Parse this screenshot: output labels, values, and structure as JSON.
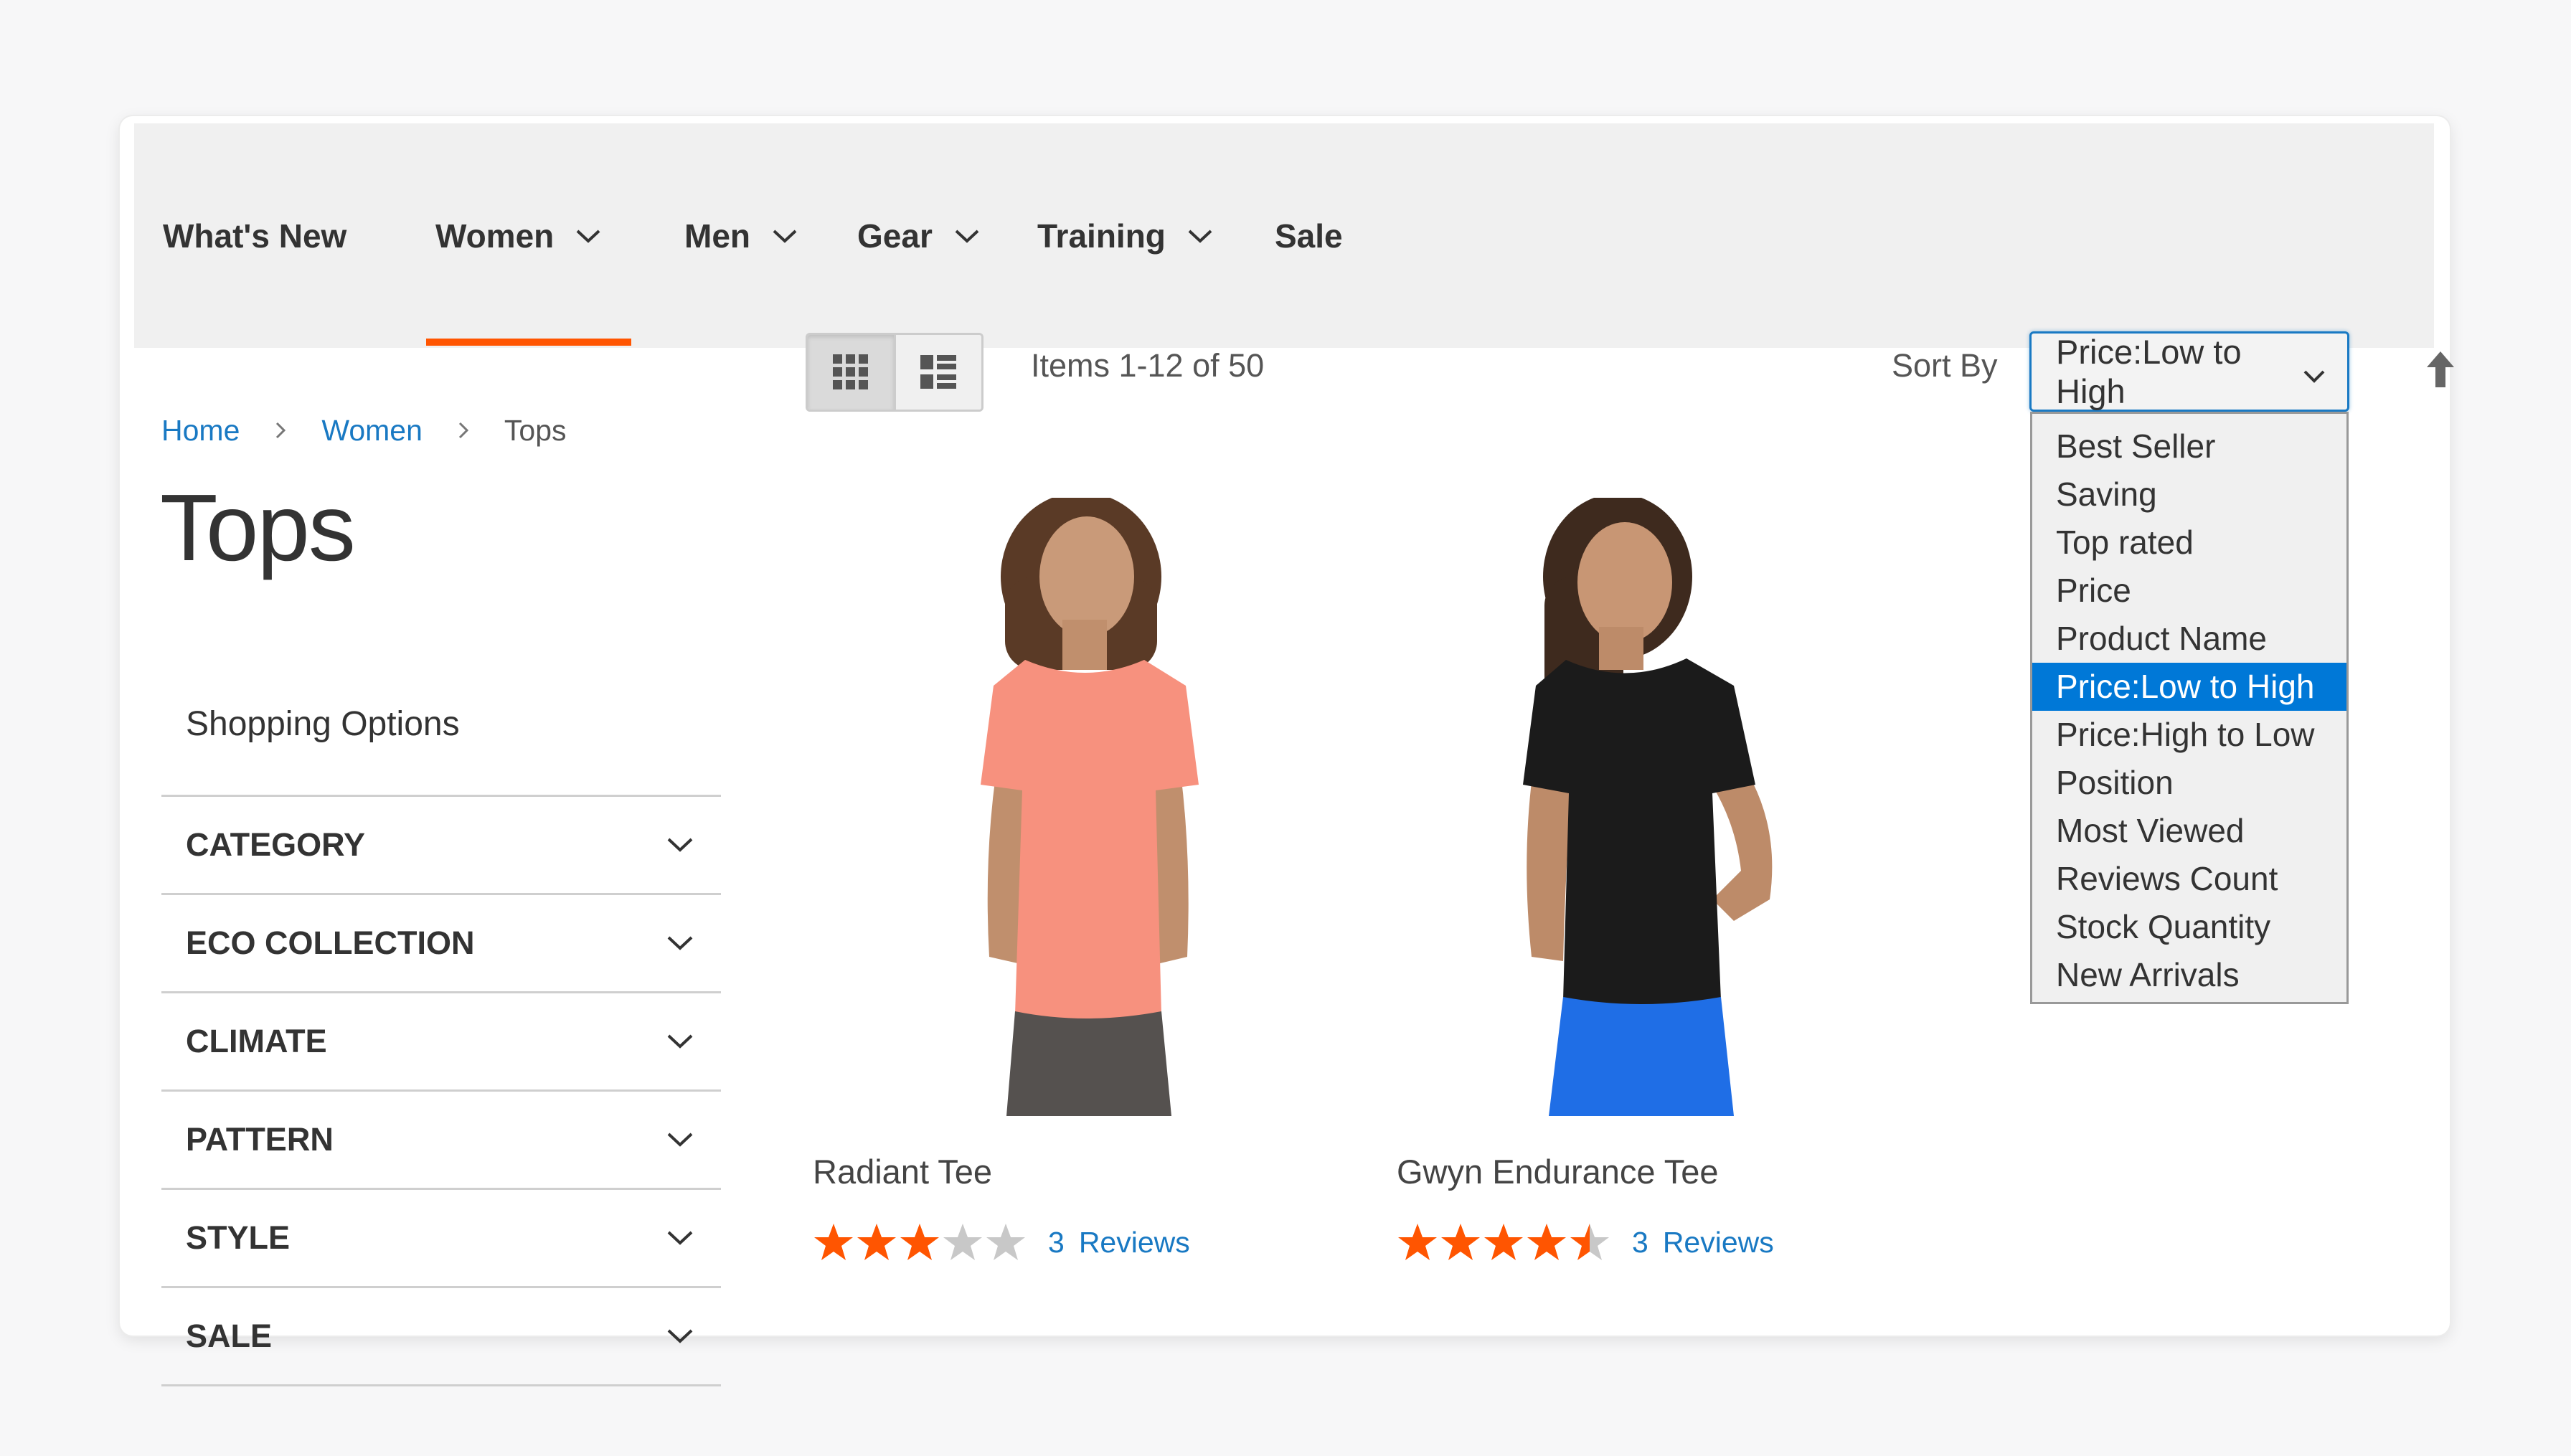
{
  "nav": {
    "items": [
      {
        "label": "What's New",
        "has_dropdown": false,
        "active": false
      },
      {
        "label": "Women",
        "has_dropdown": true,
        "active": true
      },
      {
        "label": "Men",
        "has_dropdown": true,
        "active": false
      },
      {
        "label": "Gear",
        "has_dropdown": true,
        "active": false
      },
      {
        "label": "Training",
        "has_dropdown": true,
        "active": false
      },
      {
        "label": "Sale",
        "has_dropdown": false,
        "active": false
      }
    ],
    "active_color": "#ff5501"
  },
  "breadcrumb": {
    "items": [
      {
        "label": "Home",
        "link": true
      },
      {
        "label": "Women",
        "link": true
      },
      {
        "label": "Tops",
        "link": false
      }
    ]
  },
  "page": {
    "title": "Tops"
  },
  "sidebar": {
    "title": "Shopping Options",
    "filters": [
      {
        "label": "CATEGORY"
      },
      {
        "label": "ECO COLLECTION"
      },
      {
        "label": "CLIMATE"
      },
      {
        "label": "PATTERN"
      },
      {
        "label": "STYLE"
      },
      {
        "label": "SALE"
      }
    ]
  },
  "toolbar": {
    "view_modes": [
      {
        "icon": "grid-view-icon",
        "active": true
      },
      {
        "icon": "list-view-icon",
        "active": false
      }
    ],
    "items_text": "Items 1-12 of 50",
    "sort_label": "Sort By",
    "sort_selected": "Price:Low to High",
    "sort_direction_icon": "arrow-up-icon",
    "sort_options": [
      "Best Seller",
      "Saving",
      "Top rated",
      "Price",
      "Product Name",
      "Price:Low to High",
      "Price:High to Low",
      "Position",
      "Most Viewed",
      "Reviews Count",
      "Stock Quantity",
      "New Arrivals"
    ],
    "selected_option_color": "#0078d7"
  },
  "products": [
    {
      "name": "Radiant Tee",
      "rating": 3,
      "max_rating": 5,
      "reviews_count": "3",
      "reviews_label": "Reviews",
      "shirt_color": "#f7917e",
      "bottom_color": "#55514f"
    },
    {
      "name": "Gwyn Endurance Tee",
      "rating": 4.5,
      "max_rating": 5,
      "reviews_count": "3",
      "reviews_label": "Reviews",
      "shirt_color": "#1b1b1b",
      "bottom_color": "#1f6ee6"
    }
  ],
  "colors": {
    "link": "#1979c3",
    "star": "#ff5501",
    "star_empty": "#c8c8c8"
  }
}
